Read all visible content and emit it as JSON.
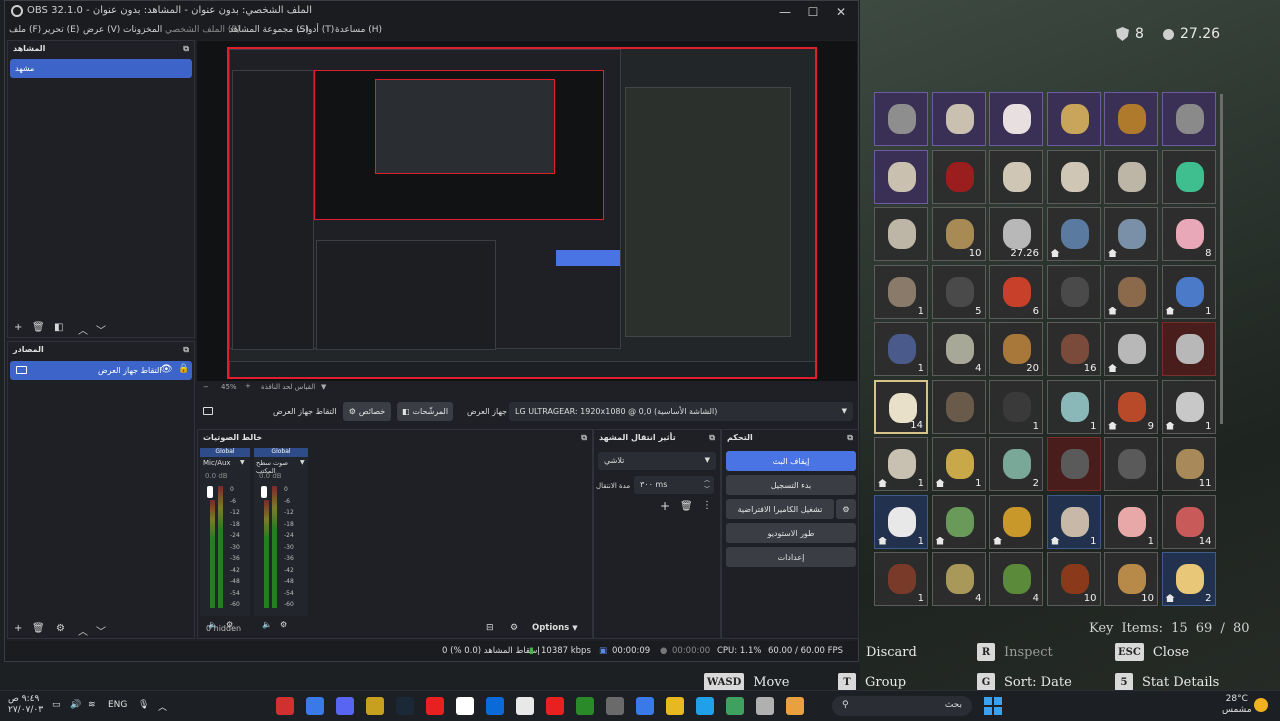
{
  "game": {
    "hud": {
      "stat_a": "8",
      "stat_b": "27.26"
    },
    "slots": [
      {
        "tint": "purple",
        "qty": "",
        "home": false,
        "color": "#8e8e8e"
      },
      {
        "tint": "purple",
        "qty": "",
        "home": false,
        "color": "#c9c0b0"
      },
      {
        "tint": "purple",
        "qty": "",
        "home": false,
        "color": "#e8e0e0"
      },
      {
        "tint": "purple",
        "qty": "",
        "home": false,
        "color": "#c8a55a"
      },
      {
        "tint": "purple",
        "qty": "",
        "home": false,
        "color": "#b07a2c"
      },
      {
        "tint": "purple",
        "qty": "",
        "home": false,
        "color": "#8a8a8a"
      },
      {
        "tint": "purple",
        "qty": "",
        "home": false,
        "color": "#c9c0b0"
      },
      {
        "tint": "",
        "qty": "",
        "home": false,
        "color": "#9a1e1e"
      },
      {
        "tint": "",
        "qty": "",
        "home": false,
        "color": "#cfc6b6"
      },
      {
        "tint": "",
        "qty": "",
        "home": false,
        "color": "#cfc6b6"
      },
      {
        "tint": "",
        "qty": "",
        "home": false,
        "color": "#bdb5a5"
      },
      {
        "tint": "",
        "qty": "",
        "home": false,
        "color": "#3fbf8f"
      },
      {
        "tint": "",
        "qty": "",
        "home": false,
        "color": "#bdb5a5"
      },
      {
        "tint": "",
        "qty": "10",
        "home": false,
        "color": "#a88a55"
      },
      {
        "tint": "",
        "qty": "27.26",
        "home": false,
        "color": "#b8b8b8"
      },
      {
        "tint": "",
        "qty": "",
        "home": true,
        "color": "#5a7aa0"
      },
      {
        "tint": "",
        "qty": "",
        "home": true,
        "color": "#7a90a8"
      },
      {
        "tint": "",
        "qty": "8",
        "home": false,
        "color": "#e8a8b8"
      },
      {
        "tint": "",
        "qty": "1",
        "home": false,
        "color": "#8a7a6a"
      },
      {
        "tint": "",
        "qty": "5",
        "home": false,
        "color": "#4a4a4a"
      },
      {
        "tint": "",
        "qty": "6",
        "home": false,
        "color": "#c8402a"
      },
      {
        "tint": "",
        "qty": "",
        "home": false,
        "color": "#4a4a4a"
      },
      {
        "tint": "",
        "qty": "",
        "home": true,
        "color": "#8a6a4a"
      },
      {
        "tint": "",
        "qty": "1",
        "home": true,
        "color": "#4a7ac8"
      },
      {
        "tint": "",
        "qty": "1",
        "home": false,
        "color": "#4a5a8a"
      },
      {
        "tint": "",
        "qty": "4",
        "home": false,
        "color": "#a8a898"
      },
      {
        "tint": "",
        "qty": "20",
        "home": false,
        "color": "#a8783a"
      },
      {
        "tint": "",
        "qty": "16",
        "home": false,
        "color": "#7a4a3a"
      },
      {
        "tint": "",
        "qty": "",
        "home": true,
        "color": "#b8b8b8"
      },
      {
        "tint": "red",
        "qty": "",
        "home": false,
        "color": "#b8b8b8"
      },
      {
        "tint": "",
        "qty": "14",
        "home": false,
        "color": "#e8e0c8",
        "sel": true
      },
      {
        "tint": "",
        "qty": "",
        "home": false,
        "color": "#6a5a4a"
      },
      {
        "tint": "",
        "qty": "1",
        "home": false,
        "color": "#3a3a3a"
      },
      {
        "tint": "",
        "qty": "1",
        "home": false,
        "color": "#8ab8b8"
      },
      {
        "tint": "",
        "qty": "9",
        "home": true,
        "color": "#b84a2a"
      },
      {
        "tint": "",
        "qty": "1",
        "home": true,
        "color": "#c8c8c8"
      },
      {
        "tint": "",
        "qty": "1",
        "home": true,
        "color": "#c8c0b0"
      },
      {
        "tint": "",
        "qty": "1",
        "home": true,
        "color": "#c8a848"
      },
      {
        "tint": "",
        "qty": "2",
        "home": false,
        "color": "#7aa898"
      },
      {
        "tint": "red",
        "qty": "",
        "home": false,
        "color": "#5a5a5a"
      },
      {
        "tint": "",
        "qty": "",
        "home": false,
        "color": "#5a5a5a"
      },
      {
        "tint": "",
        "qty": "11",
        "home": false,
        "color": "#a88a5a"
      },
      {
        "tint": "blue",
        "qty": "1",
        "home": true,
        "color": "#e8e8e8"
      },
      {
        "tint": "",
        "qty": "",
        "home": true,
        "color": "#6a9a5a"
      },
      {
        "tint": "",
        "qty": "",
        "home": true,
        "color": "#c8982a"
      },
      {
        "tint": "blue",
        "qty": "1",
        "home": true,
        "color": "#c8b8a8"
      },
      {
        "tint": "",
        "qty": "1",
        "home": false,
        "color": "#e8a8a8"
      },
      {
        "tint": "",
        "qty": "14",
        "home": false,
        "color": "#c85a5a"
      },
      {
        "tint": "",
        "qty": "1",
        "home": false,
        "color": "#7a3a2a"
      },
      {
        "tint": "",
        "qty": "4",
        "home": false,
        "color": "#a8985a"
      },
      {
        "tint": "",
        "qty": "4",
        "home": false,
        "color": "#5a8a3a"
      },
      {
        "tint": "",
        "qty": "10",
        "home": false,
        "color": "#8a3a1a"
      },
      {
        "tint": "",
        "qty": "10",
        "home": false,
        "color": "#b88a4a"
      },
      {
        "tint": "blue",
        "qty": "2",
        "home": true,
        "color": "#e8c878"
      }
    ],
    "key_items": "Key Items: 15    69 / 80",
    "hints": {
      "discard": "Discard",
      "inspect_key": "R",
      "inspect": "Inspect",
      "close_key": "ESC",
      "close": "Close",
      "move_key": "WASD",
      "move": "Move",
      "group": "Group",
      "sort_key": "G",
      "sort": "Sort: Date",
      "stat_key": "5",
      "stat": "Stat Details"
    }
  },
  "obs": {
    "title": "OBS 32.1.0 - الملف الشخصي: بدون عنوان - المشاهد: بدون عنوان",
    "menu": [
      "ملف (F)",
      "تحرير (E)",
      "عرض (V)",
      "المخزونات",
      "الملف الشخصي (P)",
      "مجموعة المشاهد (S)",
      "أدوات (T)",
      "مساعدة (H)"
    ],
    "scenes": {
      "title": "المشاهد",
      "items": [
        "مشهد"
      ]
    },
    "sources": {
      "title": "المصادر",
      "items": [
        "التقاط جهاز العرض"
      ]
    },
    "preview": {
      "zoom": "45%",
      "mode": "القياس لحد النافذة"
    },
    "source_bar": {
      "source_name": "التقاط جهاز العرض",
      "properties": "خصائص",
      "filters": "المرشّحات",
      "display_label": "جهاز العرض",
      "display_value": "LG ULTRAGEAR: 1920x1080 @ 0,0 (الشاشة الأساسية)"
    },
    "mixer": {
      "title": "خالط الصوتيات",
      "channels": [
        {
          "badge": "Global",
          "name": "Mic/Aux",
          "db": "0.0 dB"
        },
        {
          "badge": "Global",
          "name": "صوت سطح المكتب",
          "db": "0.0 dB"
        }
      ],
      "ticks": [
        "0",
        "-6",
        "-12",
        "-18",
        "-24",
        "-30",
        "-36",
        "-42",
        "-48",
        "-54",
        "-60"
      ],
      "hidden": "0 hidden",
      "options": "Options"
    },
    "transitions": {
      "title": "تأثير انتقال المشهد",
      "type": "تلاشي",
      "duration_label": "مدة الانتقال",
      "duration": "٣٠٠ ms"
    },
    "controls": {
      "title": "التحكم",
      "stop_stream": "إيقاف البث",
      "start_recording": "بدء التسجيل",
      "virtual_cam": "تشغيل الكاميرا الافتراضية",
      "studio_mode": "طور الاستوديو",
      "settings": "إعدادات"
    },
    "status": {
      "dropped": "إسقاط المشاهد (0.0 %) 0",
      "bitrate": "10387 kbps",
      "stream_time": "00:00:09",
      "rec_time": "00:00:00",
      "cpu": "CPU: 1.1%",
      "fps": "60.00 / 60.00 FPS"
    }
  },
  "taskbar": {
    "clock_time": "٩:٤٩ ص",
    "clock_date": "٢٧/٠٧/٠٣",
    "lang": "ENG",
    "search_placeholder": "بحث",
    "weather_temp": "28°C",
    "weather_desc": "مشمس",
    "apps": [
      "#d03030",
      "#3a7ae8",
      "#5865f2",
      "#c8a020",
      "#1b2838",
      "#e82020",
      "#ffffff",
      "#0a6ad8",
      "#e8e8e8",
      "#e82020",
      "#2a8a2a",
      "#6a6a6a",
      "#3a7ae8",
      "#e8b820",
      "#20a0e8",
      "#40a060",
      "#b0b0b0",
      "#e8a040"
    ]
  }
}
